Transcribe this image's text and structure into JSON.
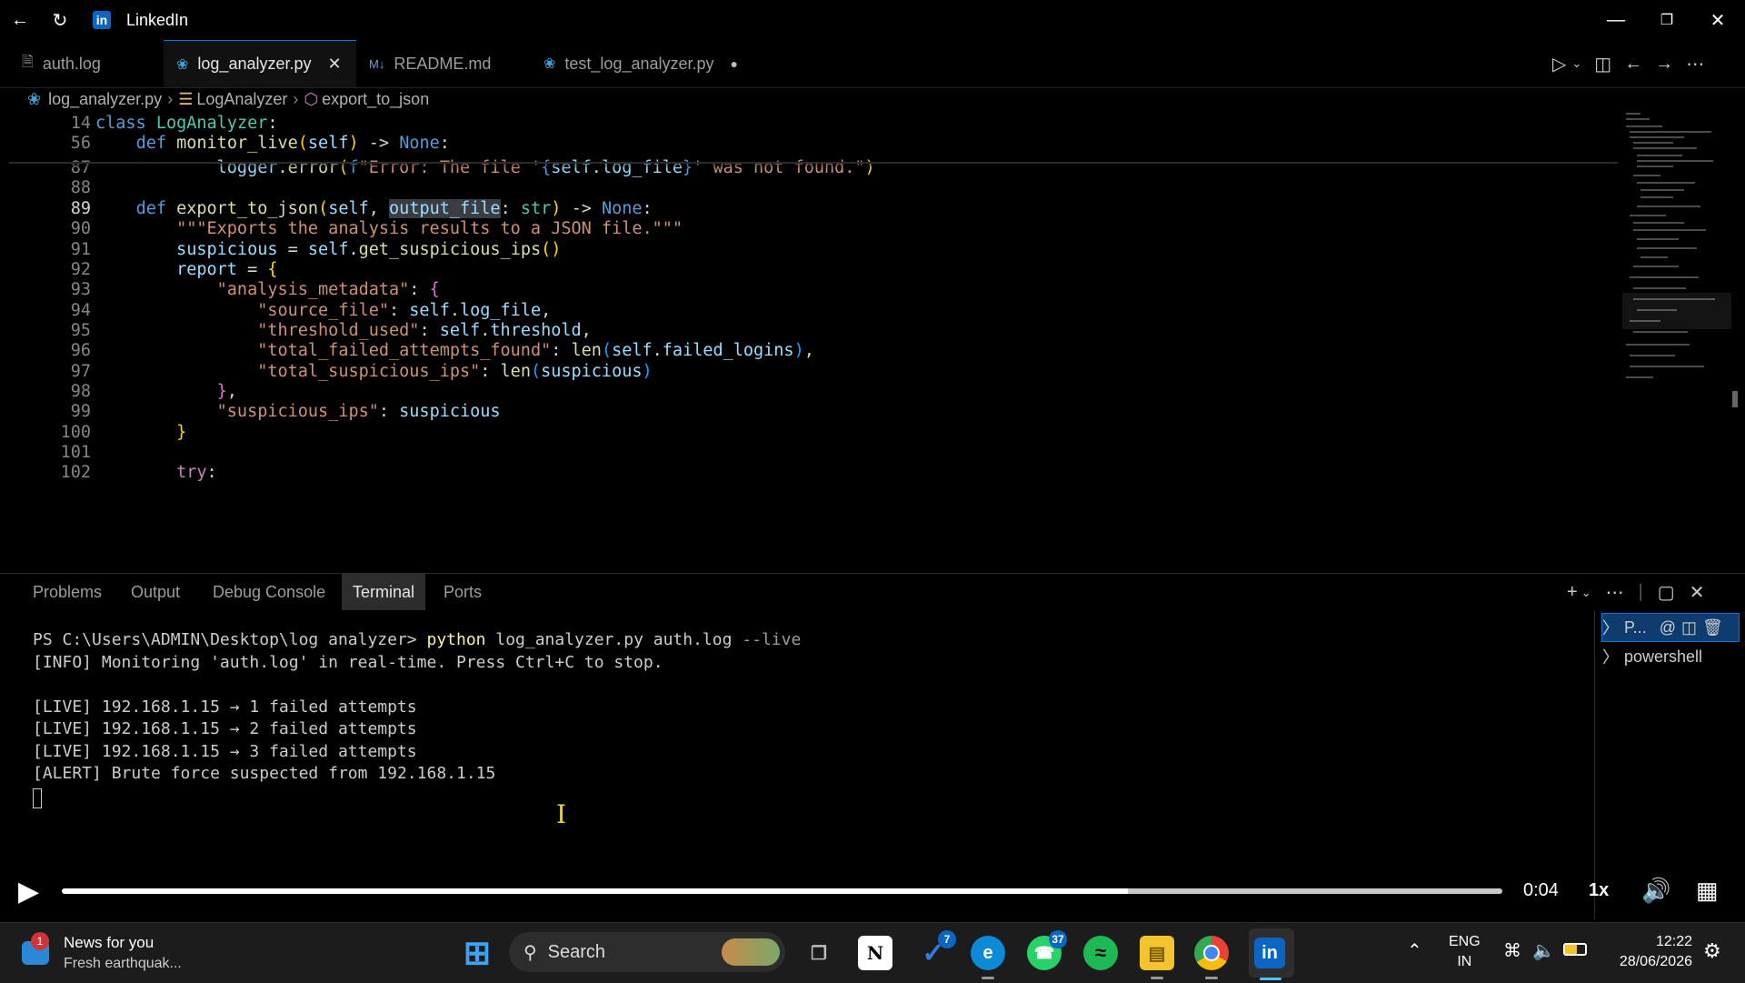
{
  "window": {
    "title": "LinkedIn"
  },
  "tabs": [
    {
      "label": "auth.log",
      "icon": "file-icon"
    },
    {
      "label": "log_analyzer.py",
      "icon": "python-icon",
      "active": true
    },
    {
      "label": "README.md",
      "icon": "markdown-icon"
    },
    {
      "label": "test_log_analyzer.py",
      "icon": "python-icon",
      "modified": true
    }
  ],
  "breadcrumb": [
    "log_analyzer.py",
    "LogAnalyzer",
    "export_to_json"
  ],
  "code": {
    "lines": [
      {
        "n": "14",
        "html": "<span class=\"kw\">class</span> <span class=\"cls\">LogAnalyzer</span><span class=\"wh\">:</span>"
      },
      {
        "n": "56",
        "html": "    <span class=\"kw\">def</span> <span class=\"fn\">monitor_live</span><span class=\"br1\">(</span><span class=\"var\">self</span><span class=\"br1\">)</span> <span class=\"wh\">-&gt;</span> <span class=\"kw\">None</span><span class=\"wh\">:</span>"
      },
      {
        "n": "87",
        "html": "            <span class=\"var\">logger</span><span class=\"wh\">.</span><span class=\"fn\">error</span><span class=\"br1\">(</span><span class=\"kw\">f</span><span class=\"str\">\"Error: The file '</span><span class=\"kw\">{</span><span class=\"var\">self</span><span class=\"wh\">.</span><span class=\"var\">log_file</span><span class=\"kw\">}</span><span class=\"str\">' was not found.\"</span><span class=\"br1\">)</span>"
      },
      {
        "n": "88",
        "html": ""
      },
      {
        "n": "89",
        "html": "    <span class=\"kw\">def</span> <span class=\"fn\">export_to_json</span><span class=\"br1\">(</span><span class=\"var\">self</span><span class=\"wh\">, </span><span class=\"var hl\">output_file</span><span class=\"wh\">: </span><span class=\"cls\">str</span><span class=\"br1\">)</span> <span class=\"wh\">-&gt;</span> <span class=\"kw\">None</span><span class=\"wh\">:</span>",
        "current": true
      },
      {
        "n": "90",
        "html": "        <span class=\"str\">\"\"\"Exports the analysis results to a JSON file.\"\"\"</span>"
      },
      {
        "n": "91",
        "html": "        <span class=\"var\">suspicious</span> <span class=\"wh\">=</span> <span class=\"var\">self</span><span class=\"wh\">.</span><span class=\"fn\">get_suspicious_ips</span><span class=\"br1\">()</span>"
      },
      {
        "n": "92",
        "html": "        <span class=\"var\">report</span> <span class=\"wh\">=</span> <span class=\"br1\">{</span>"
      },
      {
        "n": "93",
        "html": "            <span class=\"str\">\"analysis_metadata\"</span><span class=\"wh\">: </span><span class=\"br2\">{</span>"
      },
      {
        "n": "94",
        "html": "                <span class=\"str\">\"source_file\"</span><span class=\"wh\">: </span><span class=\"var\">self</span><span class=\"wh\">.</span><span class=\"var\">log_file</span><span class=\"wh\">,</span>"
      },
      {
        "n": "95",
        "html": "                <span class=\"str\">\"threshold_used\"</span><span class=\"wh\">: </span><span class=\"var\">self</span><span class=\"wh\">.</span><span class=\"var\">threshold</span><span class=\"wh\">,</span>"
      },
      {
        "n": "96",
        "html": "                <span class=\"str\">\"total_failed_attempts_found\"</span><span class=\"wh\">: </span><span class=\"fn\">len</span><span class=\"br3\">(</span><span class=\"var\">self</span><span class=\"wh\">.</span><span class=\"var\">failed_logins</span><span class=\"br3\">)</span><span class=\"wh\">,</span>"
      },
      {
        "n": "97",
        "html": "                <span class=\"str\">\"total_suspicious_ips\"</span><span class=\"wh\">: </span><span class=\"fn\">len</span><span class=\"br3\">(</span><span class=\"var\">suspicious</span><span class=\"br3\">)</span>"
      },
      {
        "n": "98",
        "html": "            <span class=\"br2\">}</span><span class=\"wh\">,</span>"
      },
      {
        "n": "99",
        "html": "            <span class=\"str\">\"suspicious_ips\"</span><span class=\"wh\">: </span><span class=\"var\">suspicious</span>"
      },
      {
        "n": "100",
        "html": "        <span class=\"br1\">}</span>"
      },
      {
        "n": "101",
        "html": ""
      },
      {
        "n": "102",
        "html": "        <span class=\"ctl\">try</span><span class=\"wh\">:</span>"
      }
    ]
  },
  "panel": {
    "tabs": [
      "Problems",
      "Output",
      "Debug Console",
      "Terminal",
      "Ports"
    ],
    "active_tab": "Terminal",
    "terminal": {
      "prompt": "PS C:\\Users\\ADMIN\\Desktop\\log analyzer> ",
      "command": "python",
      "args": " log_analyzer.py auth.log ",
      "flag": "--live",
      "output": [
        "[INFO] Monitoring 'auth.log' in real-time. Press Ctrl+C to stop.",
        "",
        "[LIVE] 192.168.1.15 → 1 failed attempts",
        "[LIVE] 192.168.1.15 → 2 failed attempts",
        "[LIVE] 192.168.1.15 → 3 failed attempts",
        "[ALERT] Brute force suspected from 192.168.1.15"
      ]
    },
    "terminal_list": [
      "P...",
      "powershell"
    ]
  },
  "video": {
    "time": "0:04",
    "speed": "1x",
    "progress": 0.74
  },
  "taskbar": {
    "news_title": "News for you",
    "news_sub": "Fresh earthquak...",
    "news_badge": "1",
    "search_label": "Search",
    "todo_badge": "7",
    "whatsapp_badge": "37",
    "lang": "ENG",
    "region": "IN",
    "time": "12:22",
    "date": "28/06/2026"
  }
}
